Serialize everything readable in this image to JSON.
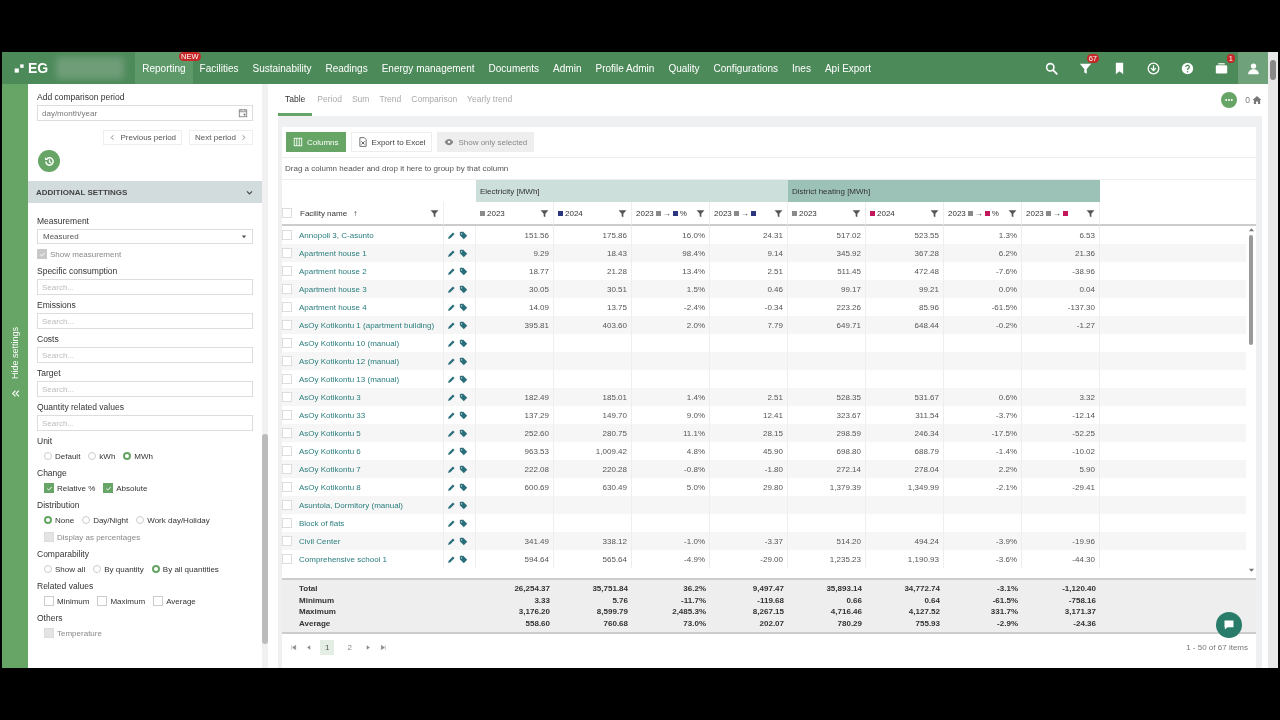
{
  "nav": {
    "logo": "EG",
    "items": [
      {
        "label": "Reporting",
        "selected": true,
        "badge": "NEW"
      },
      {
        "label": "Facilities",
        "selected": false
      },
      {
        "label": "Sustainability",
        "selected": false
      },
      {
        "label": "Readings",
        "selected": false
      },
      {
        "label": "Energy management",
        "selected": false
      },
      {
        "label": "Documents",
        "selected": false
      },
      {
        "label": "Admin",
        "selected": false
      },
      {
        "label": "Profile Admin",
        "selected": false
      },
      {
        "label": "Quality",
        "selected": false
      },
      {
        "label": "Configurations",
        "selected": false
      },
      {
        "label": "Ines",
        "selected": false
      },
      {
        "label": "Api Export",
        "selected": false
      }
    ],
    "icons": [
      {
        "kind": "search"
      },
      {
        "kind": "filter",
        "badge": "67"
      },
      {
        "kind": "bookmark"
      },
      {
        "kind": "download"
      },
      {
        "kind": "help"
      },
      {
        "kind": "inbox",
        "badge": "1"
      },
      {
        "kind": "user"
      }
    ]
  },
  "settings": {
    "toggle_label": "Hide settings",
    "comparison": {
      "label": "Add comparison period",
      "placeholder": "day/month/year"
    },
    "period_buttons": [
      {
        "kind": "prev",
        "label": "Previous period"
      },
      {
        "kind": "next",
        "label": "Next period"
      }
    ],
    "section": {
      "title": "ADDITIONAL SETTINGS",
      "expanded": true
    },
    "measurement": {
      "label": "Measurement",
      "value": "Measured"
    },
    "groups": [
      {
        "kind": "checkbox",
        "label": "Show measurement",
        "checked": true,
        "disabled": true
      },
      {
        "kind": "search",
        "label": "Specific consumption",
        "placeholder": "Search..."
      },
      {
        "kind": "search",
        "label": "Emissions",
        "placeholder": "Search..."
      },
      {
        "kind": "search",
        "label": "Costs",
        "placeholder": "Search..."
      },
      {
        "kind": "search",
        "label": "Target",
        "placeholder": "Search..."
      },
      {
        "kind": "search",
        "label": "Quantity related values",
        "placeholder": "Search..."
      },
      {
        "kind": "options",
        "label": "Unit",
        "rows": [
          [
            {
              "kind": "radio",
              "label": "Default",
              "selected": false
            },
            {
              "kind": "radio",
              "label": "kWh",
              "selected": false
            },
            {
              "kind": "radio",
              "label": "MWh",
              "selected": true
            }
          ]
        ]
      },
      {
        "kind": "options",
        "label": "Change",
        "rows": [
          [
            {
              "kind": "checkbox",
              "label": "Relative %",
              "checked": true,
              "disabled": false
            },
            {
              "kind": "checkbox",
              "label": "Absolute",
              "checked": true,
              "disabled": false
            }
          ]
        ]
      },
      {
        "kind": "options",
        "label": "Distribution",
        "rows": [
          [
            {
              "kind": "radio",
              "label": "None",
              "selected": true
            },
            {
              "kind": "radio",
              "label": "Day/Night",
              "selected": false
            },
            {
              "kind": "radio",
              "label": "Work day/Holiday",
              "selected": false
            }
          ],
          [
            {
              "kind": "checkbox",
              "label": "Display as percentages",
              "checked": false,
              "disabled": true
            }
          ]
        ]
      },
      {
        "kind": "options",
        "label": "Comparability",
        "rows": [
          [
            {
              "kind": "radio",
              "label": "Show all",
              "selected": false
            },
            {
              "kind": "radio",
              "label": "By quantity",
              "selected": false
            },
            {
              "kind": "radio",
              "label": "By all quantities",
              "selected": true
            }
          ]
        ]
      },
      {
        "kind": "options",
        "label": "Related values",
        "rows": [
          [
            {
              "kind": "checkbox",
              "label": "Minimum",
              "checked": false,
              "disabled": false
            },
            {
              "kind": "checkbox",
              "label": "Maximum",
              "checked": false,
              "disabled": false
            },
            {
              "kind": "checkbox",
              "label": "Average",
              "checked": false,
              "disabled": false
            }
          ]
        ]
      },
      {
        "kind": "options",
        "label": "Others",
        "rows": [
          [
            {
              "kind": "checkbox",
              "label": "Temperature",
              "checked": false,
              "disabled": true
            }
          ]
        ]
      }
    ]
  },
  "tabs": [
    {
      "label": "Table",
      "selected": true
    },
    {
      "label": "Period",
      "selected": false
    },
    {
      "label": "Sum",
      "selected": false
    },
    {
      "label": "Trend",
      "selected": false
    },
    {
      "label": "Comparison",
      "selected": false
    },
    {
      "label": "Yearly trend",
      "selected": false
    }
  ],
  "top_right": {
    "count": "0"
  },
  "toolbar": [
    {
      "kind": "columns",
      "label": "Columns",
      "disabled": false
    },
    {
      "kind": "excel",
      "label": "Export to Excel",
      "disabled": false
    },
    {
      "kind": "eye",
      "label": "Show only selected",
      "disabled": true
    }
  ],
  "group_hint": "Drag a column header and drop it here to group by that column",
  "table": {
    "name_column": "Facility name",
    "sort_indicator": "↑",
    "all_selected": false,
    "groups": [
      {
        "label": "Electricity [MWh]",
        "color": "#cddfdb",
        "columns": [
          {
            "kind": "year",
            "label": "2023",
            "color": "#8a8a8a"
          },
          {
            "kind": "year",
            "label": "2024",
            "color": "#2b3580"
          },
          {
            "kind": "change",
            "label": "2023",
            "arrow": "→",
            "suffix": "%"
          },
          {
            "kind": "change",
            "label": "2023",
            "arrow": "→"
          }
        ]
      },
      {
        "label": "District heating [MWh]",
        "color": "#9cc2b8",
        "columns": [
          {
            "kind": "year",
            "label": "2023",
            "color": "#8a8a8a"
          },
          {
            "kind": "year",
            "label": "2024",
            "color": "#c2185b"
          },
          {
            "kind": "change",
            "label": "2023",
            "arrow": "→",
            "suffix": "%"
          },
          {
            "kind": "change",
            "label": "2023",
            "arrow": "→"
          }
        ]
      }
    ],
    "rows": [
      {
        "name": "Annopoli 3, C-asunto",
        "selected": false,
        "values": [
          "151.56",
          "175.86",
          "16.0%",
          "24.31",
          "517.02",
          "523.55",
          "1.3%",
          "6.53"
        ]
      },
      {
        "name": "Apartment house 1",
        "selected": false,
        "values": [
          "9.29",
          "18.43",
          "98.4%",
          "9.14",
          "345.92",
          "367.28",
          "6.2%",
          "21.36"
        ]
      },
      {
        "name": "Apartment house 2",
        "selected": false,
        "values": [
          "18.77",
          "21.28",
          "13.4%",
          "2.51",
          "511.45",
          "472.48",
          "-7.6%",
          "-38.96"
        ]
      },
      {
        "name": "Apartment house 3",
        "selected": false,
        "values": [
          "30.05",
          "30.51",
          "1.5%",
          "0.46",
          "99.17",
          "99.21",
          "0.0%",
          "0.04"
        ]
      },
      {
        "name": "Apartment house 4",
        "selected": false,
        "values": [
          "14.09",
          "13.75",
          "-2.4%",
          "-0.34",
          "223.26",
          "85.96",
          "-61.5%",
          "-137.30"
        ]
      },
      {
        "name": "AsOy Kotikontu 1 (apartment building)",
        "selected": false,
        "values": [
          "395.81",
          "403.60",
          "2.0%",
          "7.79",
          "649.71",
          "648.44",
          "-0.2%",
          "-1.27"
        ]
      },
      {
        "name": "AsOy Kotikontu 10 (manual)",
        "selected": false
      },
      {
        "name": "AsOy Kotikontu 12 (manual)",
        "selected": false
      },
      {
        "name": "AsOy Kotikontu 13 (manual)",
        "selected": false
      },
      {
        "name": "AsOy Kotikontu 3",
        "selected": false,
        "values": [
          "182.49",
          "185.01",
          "1.4%",
          "2.51",
          "528.35",
          "531.67",
          "0.6%",
          "3.32"
        ]
      },
      {
        "name": "AsOy Kotikontu 33",
        "selected": false,
        "values": [
          "137.29",
          "149.70",
          "9.0%",
          "12.41",
          "323.67",
          "311.54",
          "-3.7%",
          "-12.14"
        ]
      },
      {
        "name": "AsOy Kotikontu 5",
        "selected": false,
        "values": [
          "252.60",
          "280.75",
          "11.1%",
          "28.15",
          "298.59",
          "246.34",
          "-17.5%",
          "-52.25"
        ]
      },
      {
        "name": "AsOy Kotikontu 6",
        "selected": false,
        "values": [
          "963.53",
          "1,009.42",
          "4.8%",
          "45.90",
          "698.80",
          "688.79",
          "-1.4%",
          "-10.02"
        ]
      },
      {
        "name": "AsOy Kotikontu 7",
        "selected": false,
        "values": [
          "222.08",
          "220.28",
          "-0.8%",
          "-1.80",
          "272.14",
          "278.04",
          "2.2%",
          "5.90"
        ]
      },
      {
        "name": "AsOy Kotikontu 8",
        "selected": false,
        "values": [
          "600.69",
          "630.49",
          "5.0%",
          "29.80",
          "1,379.39",
          "1,349.99",
          "-2.1%",
          "-29.41"
        ]
      },
      {
        "name": "Asuntola, Dormitory (manual)",
        "selected": false
      },
      {
        "name": "Block of flats",
        "selected": false
      },
      {
        "name": "Civil Center",
        "selected": false,
        "values": [
          "341.49",
          "338.12",
          "-1.0%",
          "-3.37",
          "514.20",
          "494.24",
          "-3.9%",
          "-19.96"
        ]
      },
      {
        "name": "Comprehensive school 1",
        "selected": false,
        "values": [
          "594.64",
          "565.64",
          "-4.9%",
          "-29.00",
          "1,235.23",
          "1,190.93",
          "-3.6%",
          "-44.30"
        ]
      }
    ],
    "summary": [
      {
        "label": "Total",
        "values": [
          "26,254.37",
          "35,751.84",
          "36.2%",
          "9,497.47",
          "35,893.14",
          "34,772.74",
          "-3.1%",
          "-1,120.40"
        ]
      },
      {
        "label": "Minimum",
        "values": [
          "3.33",
          "5.76",
          "-11.7%",
          "-119.68",
          "0.66",
          "0.64",
          "-61.5%",
          "-758.16"
        ]
      },
      {
        "label": "Maximum",
        "values": [
          "3,176.20",
          "8,599.79",
          "2,485.3%",
          "8,267.15",
          "4,716.46",
          "4,127.52",
          "331.7%",
          "3,171.37"
        ]
      },
      {
        "label": "Average",
        "values": [
          "558.60",
          "760.68",
          "73.0%",
          "202.07",
          "780.29",
          "755.93",
          "-2.9%",
          "-24.36"
        ]
      }
    ]
  },
  "pager": {
    "pages": [
      {
        "label": "1",
        "selected": true
      },
      {
        "label": "2",
        "selected": false
      }
    ],
    "info": "1 - 50 of 67 items"
  }
}
